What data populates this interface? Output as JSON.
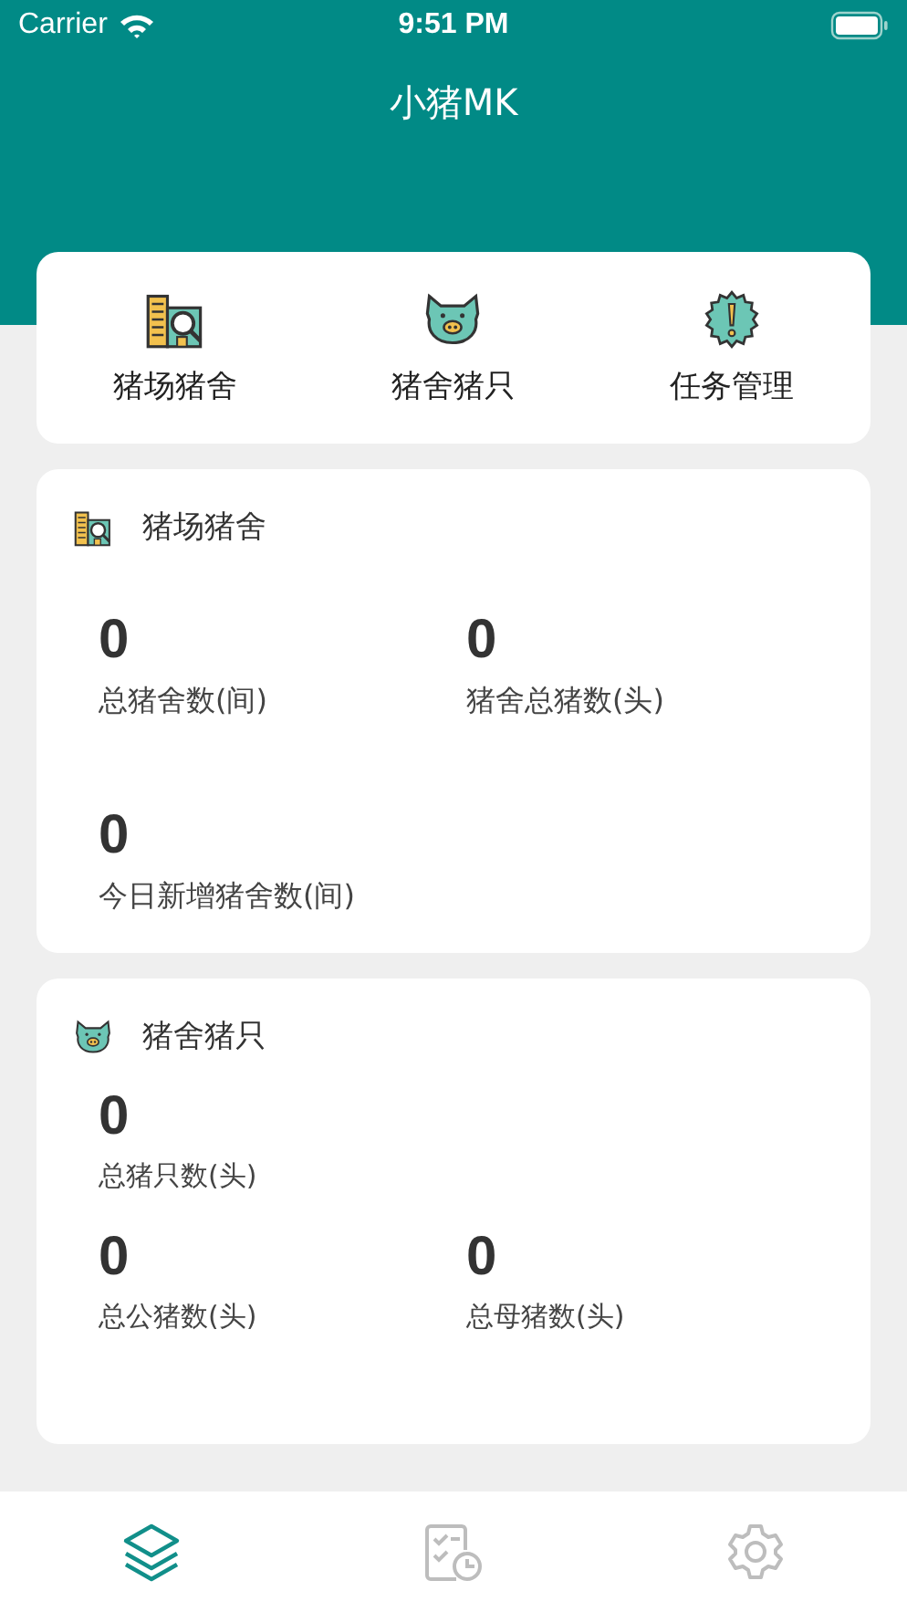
{
  "status_bar": {
    "carrier": "Carrier",
    "time": "9:51 PM"
  },
  "header": {
    "title": "小猪MK"
  },
  "shortcuts": [
    {
      "kind": "farm",
      "label": "猪场猪舍"
    },
    {
      "kind": "pig",
      "label": "猪舍猪只"
    },
    {
      "kind": "task",
      "label": "任务管理"
    }
  ],
  "sections": [
    {
      "kind": "farm",
      "title": "猪场猪舍",
      "stats": [
        {
          "value": "0",
          "label": "总猪舍数(间)"
        },
        {
          "value": "0",
          "label": "猪舍总猪数(头)"
        },
        {
          "value": "0",
          "label": "今日新增猪舍数(间)"
        }
      ]
    },
    {
      "kind": "pig",
      "title": "猪舍猪只",
      "stats": [
        {
          "value": "0",
          "label": "总猪只数(头)"
        },
        {
          "value": "0",
          "label": "总公猪数(头)"
        },
        {
          "value": "0",
          "label": "总母猪数(头)"
        }
      ]
    }
  ],
  "tab_bar": [
    {
      "kind": "layers",
      "selected": true
    },
    {
      "kind": "tasks",
      "selected": false
    },
    {
      "kind": "settings",
      "selected": false
    }
  ]
}
